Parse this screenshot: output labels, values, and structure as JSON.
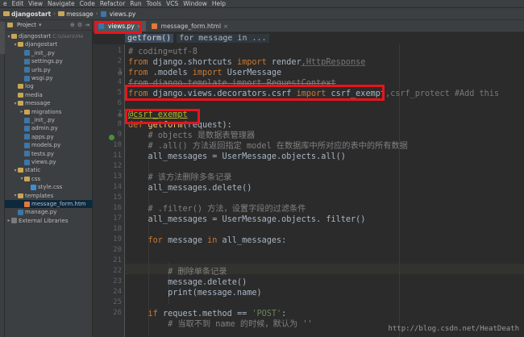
{
  "menubar": {
    "items": [
      "e",
      "Edit",
      "View",
      "Navigate",
      "Code",
      "Refactor",
      "Run",
      "Tools",
      "VCS",
      "Window",
      "Help"
    ]
  },
  "navbar": {
    "project": "djangostart",
    "folder": "message",
    "file": "views.py"
  },
  "project_panel": {
    "title": "Project",
    "tree": [
      {
        "label": "djangostart",
        "extra": "C:\\Users\\He",
        "type": "folder",
        "depth": 0,
        "expanded": true
      },
      {
        "label": "djangostart",
        "type": "folder",
        "depth": 1,
        "expanded": true
      },
      {
        "label": "_init_.py",
        "type": "py",
        "depth": 2
      },
      {
        "label": "settings.py",
        "type": "py",
        "depth": 2
      },
      {
        "label": "urls.py",
        "type": "py",
        "depth": 2
      },
      {
        "label": "wsgi.py",
        "type": "py",
        "depth": 2
      },
      {
        "label": "log",
        "type": "folder",
        "depth": 1
      },
      {
        "label": "media",
        "type": "folder",
        "depth": 1
      },
      {
        "label": "message",
        "type": "folder",
        "depth": 1,
        "expanded": true
      },
      {
        "label": "migrations",
        "type": "folder",
        "depth": 2,
        "collapsed": true
      },
      {
        "label": "_init_.py",
        "type": "py",
        "depth": 2
      },
      {
        "label": "admin.py",
        "type": "py",
        "depth": 2
      },
      {
        "label": "apps.py",
        "type": "py",
        "depth": 2
      },
      {
        "label": "models.py",
        "type": "py",
        "depth": 2
      },
      {
        "label": "tests.py",
        "type": "py",
        "depth": 2
      },
      {
        "label": "views.py",
        "type": "py",
        "depth": 2
      },
      {
        "label": "static",
        "type": "folder",
        "depth": 1,
        "expanded": true
      },
      {
        "label": "css",
        "type": "folder",
        "depth": 2,
        "expanded": true
      },
      {
        "label": "style.css",
        "type": "css",
        "depth": 3
      },
      {
        "label": "templates",
        "type": "folder",
        "depth": 1,
        "expanded": true
      },
      {
        "label": "message_form.htm",
        "type": "html",
        "depth": 2,
        "selected": true
      },
      {
        "label": "manage.py",
        "type": "py",
        "depth": 1
      },
      {
        "label": "External Libraries",
        "type": "lib",
        "depth": 0,
        "collapsed": true
      }
    ]
  },
  "tabs": [
    {
      "label": "views.py",
      "active": true
    },
    {
      "label": "message_form.html",
      "active": false
    }
  ],
  "editor_breadcrumb": {
    "function": "getform()",
    "context": "for message in ..."
  },
  "code": {
    "line_numbers": [
      "1",
      "2",
      "3",
      "4",
      "5",
      "6",
      "7",
      "8",
      "9",
      "10",
      "11",
      "12",
      "13",
      "14",
      "15",
      "16",
      "17",
      "18",
      "19",
      "20",
      "21",
      "22",
      "23",
      "24",
      "25",
      "26"
    ],
    "l1": "# coding=utf-8",
    "l2_kw1": "from",
    "l2_mod": " django.shortcuts ",
    "l2_kw2": "import",
    "l2_rest": " render",
    "l2_un": ",HttpResponse",
    "l3_kw1": "from",
    "l3_mod": " .models ",
    "l3_kw2": "import",
    "l3_rest": " UserMessage",
    "l4_strike": "from django.template import RequestContext",
    "l5_kw1": "from",
    "l5_mod": " django.views.decorators.csrf ",
    "l5_kw2": "import",
    "l5_rest": " csrf_exempt",
    "l5_un": ",csrf_protect #Add this",
    "l7_dec": "@csrf_exempt",
    "l8_kw": "def",
    "l8_fn": " getform",
    "l8_rest": "(request):",
    "l9": "    # objects 是数据表管理器",
    "l10": "    # .all() 方法返回指定 model 在数据库中所对应的表中的所有数据",
    "l11": "    all_messages = UserMessage.objects.all()",
    "l13": "    # 该方法删除多条记录",
    "l14": "    all_messages.delete()",
    "l16": "    # .filter() 方法，设置字段的过滤条件",
    "l17": "    all_messages = UserMessage.objects. filter()",
    "l19_kw1": "    for",
    "l19_mid": " message ",
    "l19_kw2": "in",
    "l19_rest": " all_messages:",
    "l21": "        # 删除单条记录",
    "l22": "        message.delete()",
    "l23": "        print(message.name)",
    "l25_kw": "    if",
    "l25_mid": " request.method == ",
    "l25_str": "'POST'",
    "l25_end": ":",
    "l26": "        # 当取不到 name 的时候，默认为 ''"
  },
  "watermark": "http://blog.csdn.net/HeatDeath",
  "colors": {
    "highlight": "#e8141c",
    "keyword": "#cc7832",
    "decorator": "#bbb529",
    "string": "#6a8759"
  }
}
